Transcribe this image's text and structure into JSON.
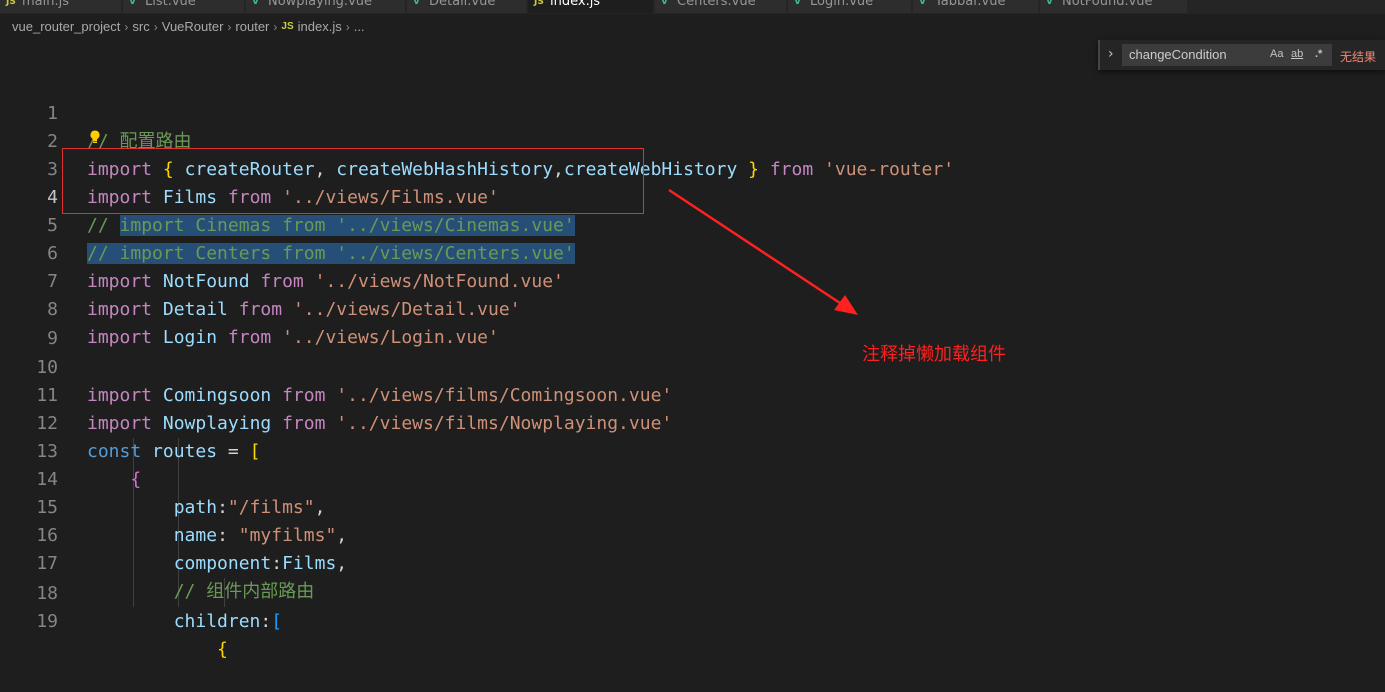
{
  "tabs": [
    {
      "label": "main.js",
      "type": "js"
    },
    {
      "label": "List.vue",
      "type": "vue"
    },
    {
      "label": "Nowplaying.vue",
      "type": "vue"
    },
    {
      "label": "Detail.vue",
      "type": "vue"
    },
    {
      "label": "index.js",
      "type": "js",
      "active": true
    },
    {
      "label": "Centers.vue",
      "type": "vue"
    },
    {
      "label": "Login.vue",
      "type": "vue"
    },
    {
      "label": "Tabbar.vue",
      "type": "vue"
    },
    {
      "label": "NotFound.vue",
      "type": "vue"
    }
  ],
  "breadcrumb": {
    "items": [
      "vue_router_project",
      "src",
      "VueRouter",
      "router"
    ],
    "file_badge": "JS",
    "file": "index.js",
    "more": "..."
  },
  "find_widget": {
    "query": "changeCondition",
    "match_case": "Aa",
    "whole_word": "ab",
    "regex": ".*",
    "result": "无结果"
  },
  "line_numbers": [
    "1",
    "2",
    "3",
    "4",
    "5",
    "6",
    "7",
    "8",
    "9",
    "10",
    "11",
    "12",
    "13",
    "14",
    "15",
    "16",
    "17",
    "18",
    "19"
  ],
  "current_line": "4",
  "code": {
    "l1": {
      "comment": "// 配置路由"
    },
    "l2": {
      "import": "import",
      "ob": "{",
      "a": "createRouter",
      "comma1": ",",
      "b": "createWebHashHistory",
      "comma2": ",",
      "c": "createWebHistory",
      "cb": "}",
      "from": "from",
      "src": "'vue-router'"
    },
    "l3": {
      "import": "import",
      "name": "Films",
      "from": "from",
      "src": "'../views/Films.vue'"
    },
    "l4": {
      "slashes": "// ",
      "text": "import Cinemas from '../views/Cinemas.vue'"
    },
    "l5": {
      "text": "// import Centers from '../views/Centers.vue'"
    },
    "l6": {
      "import": "import",
      "name": "NotFound",
      "from": "from",
      "src": "'../views/NotFound.vue'"
    },
    "l7": {
      "import": "import",
      "name": "Detail",
      "from": "from",
      "src": "'../views/Detail.vue'"
    },
    "l8": {
      "import": "import",
      "name": "Login",
      "from": "from",
      "src": "'../views/Login.vue'"
    },
    "l10": {
      "import": "import",
      "name": "Comingsoon",
      "from": "from",
      "src": "'../views/films/Comingsoon.vue'"
    },
    "l11": {
      "import": "import",
      "name": "Nowplaying",
      "from": "from",
      "src": "'../views/films/Nowplaying.vue'"
    },
    "l12": {
      "const": "const",
      "name": "routes",
      "eq": " = ",
      "br": "["
    },
    "l13": {
      "br": "{"
    },
    "l14": {
      "key": "path",
      "colon": ":",
      "val": "\"/films\"",
      "comma": ","
    },
    "l15": {
      "key": "name",
      "colon": ": ",
      "val": "\"myfilms\"",
      "comma": ","
    },
    "l16": {
      "key": "component",
      "colon": ":",
      "val": "Films",
      "comma": ","
    },
    "l17": {
      "comment": "// 组件内部路由"
    },
    "l18": {
      "key": "children",
      "colon": ":",
      "br": "["
    },
    "l19": {
      "br": "{"
    }
  },
  "annotation": "注释掉懒加载组件",
  "colors": {
    "background": "#1e1e1e",
    "selection": "#264f78",
    "annotation_red": "#ff2020",
    "keyword": "#c586c0",
    "string": "#ce9178",
    "comment": "#6a9955"
  }
}
